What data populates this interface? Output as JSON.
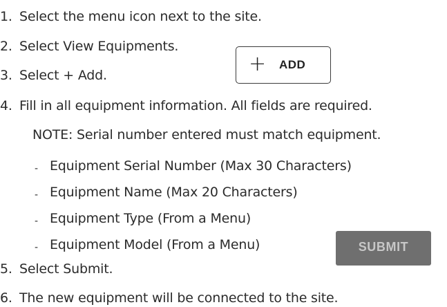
{
  "steps": [
    {
      "number": "1.",
      "text": "Select the menu icon next to the site."
    },
    {
      "number": "2.",
      "text": "Select View Equipments."
    },
    {
      "number": "3.",
      "text": "Select + Add."
    },
    {
      "number": "4.",
      "text": "Fill in all equipment information. All fields are required."
    },
    {
      "number": "5.",
      "text": "Select Submit."
    },
    {
      "number": "6.",
      "text": "The new equipment will be connected to the site."
    }
  ],
  "note": "NOTE: Serial number entered must match equipment.",
  "fields": [
    {
      "bullet": "-",
      "text": "Equipment Serial Number (Max 30 Characters)"
    },
    {
      "bullet": "-",
      "text": "Equipment Name (Max 20 Characters)"
    },
    {
      "bullet": "-",
      "text": "Equipment Type (From a Menu)"
    },
    {
      "bullet": "-",
      "text": "Equipment Model (From a Menu)"
    }
  ],
  "add_button": {
    "icon": "plus-icon",
    "label": "ADD"
  },
  "submit_button": {
    "label": "SUBMIT"
  }
}
